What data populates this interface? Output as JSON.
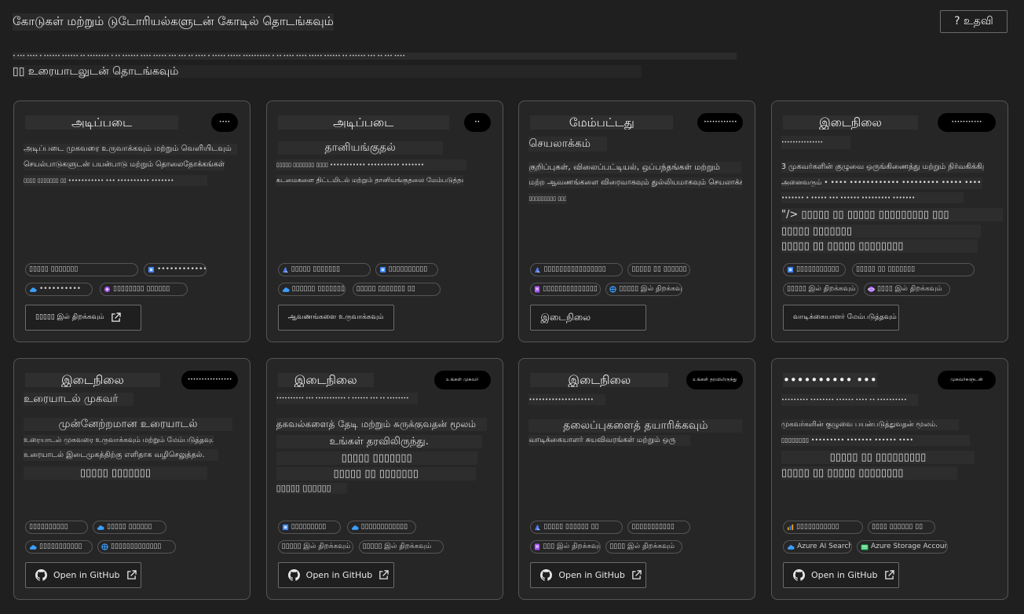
{
  "header": {
    "title": "கோடுகள் மற்றும் டுடோரியல்களுடன் கோடில் தொடங்கவும்",
    "help_label": "? உதவி",
    "subtitle": "• ••• •••• • •••••• •••••• •• •••••••• • •• •••••• •••• ••••• ••• ••• •• •••• • ••••• ••••• •••••••••• • •• •••• •••• ••••• •••••• •• •••••• ••• •• ••• ••••",
    "section_heading": "▯▯ உரையாடலுடன் தொடங்கவும்"
  },
  "colors": {
    "background": "#1f1f1f",
    "card_background": "#262626",
    "card_border": "#555555",
    "text": "#e6e6e6",
    "badge_background": "#000000"
  },
  "cards": [
    {
      "title": "அடிப்படை",
      "badge": "••••",
      "lines": [
        "அடிப்படை முகவரை உருவாக்கவும் மற்றும் வெளியிடவும்",
        "செயல்பாடுகளுடன் பயன்பாடு மற்றும் தொலைநோக்கங்கள்",
        "▯▯▯▯ ▯▯▯▯▯▯▯ ▯▯ ••••••••••• ••• •••••••••• •••••••"
      ],
      "tags": [
        {
          "label": "▯▯▯▯▯ ▯▯▯▯▯▯▯",
          "icon": "none",
          "color": ""
        },
        {
          "label": "•••••••••••••••",
          "icon": "cube-icon",
          "color": "#3b82f6"
        },
        {
          "label": "••••••••••",
          "icon": "cloud-icon",
          "color": "#3b9eff"
        },
        {
          "label": "▯▯▯▯▯▯▯▯ ▯▯▯▯▯▯",
          "icon": "sparkle-icon",
          "color": "#a855f7"
        }
      ],
      "button": "▯▯▯▯▯ இல் திறக்கவும்"
    },
    {
      "title": "அடிப்படை",
      "badge": "••",
      "lines": [
        "தானியங்குதல்",
        "▯▯▯▯▯ ▯▯▯▯▯▯▯ ▯▯▯▯ ••••••••••• •••••••••• •••••••",
        "கடமைகளை திட்டமிடல் மற்றும் தானியங்குதலை மேம்படுத்தவும்"
      ],
      "tags": [
        {
          "label": "▯▯▯▯▯ ▯▯▯▯▯▯▯",
          "icon": "azure-icon",
          "color": "#4f7cff"
        },
        {
          "label": "▯▯▯▯▯▯▯▯▯▯",
          "icon": "cube-icon",
          "color": "#3b82f6"
        },
        {
          "label": "▯▯▯▯▯▯ ▯▯▯▯▯▯▯ ▯▯",
          "icon": "cloud-icon",
          "color": "#3b9eff"
        },
        {
          "label": "▯▯▯▯▯ ▯▯▯▯▯▯▯ ▯▯",
          "icon": "none",
          "color": ""
        }
      ],
      "button": "ஆவணங்களை உருவாக்கவும்"
    },
    {
      "title": "மேம்பட்டது",
      "badge": "••••••••••••",
      "lines": [
        "செயலாக்கம்",
        "குறிப்புகள், விலைப்பட்டியல், ஒப்பந்தங்கள் மற்றும்",
        "மற்ற ஆவணங்களை விரைவாகவும் துல்லியமாகவும் செயலாக்கவும்",
        "▯▯▯▯▯▯▯▯▯ ▯▯▯▯▯▯"
      ],
      "tags": [
        {
          "label": "▯▯▯▯▯▯▯▯▯▯▯▯▯▯▯▯",
          "icon": "azure-icon",
          "color": "#4f7cff"
        },
        {
          "label": "▯▯▯▯▯ ▯▯ ▯▯▯▯▯▯",
          "icon": "none",
          "color": ""
        },
        {
          "label": "▯▯▯▯▯▯▯▯▯▯▯▯▯▯",
          "icon": "doc-icon",
          "color": "#a855f7"
        },
        {
          "label": "▯▯▯▯▯ இல் திறக்கவும்",
          "icon": "globe-icon",
          "color": "#3b9eff"
        }
      ],
      "button": "இடைநிலை"
    },
    {
      "title": "இடைநிலை",
      "badge": "•••••••••••",
      "lines": [
        "•••••••••••••••",
        "3 முகவர்களின் குழுவை ஒருங்கிணைத்து மற்றும் நிர்வகிக்கிறது",
        "அனைவரும் • •••• •••••••••••• ••••••••• ••••• ••••",
        "••••••• • ••••• ••• •••••• ••••••••• •••••••",
        "\"/> ▯▯▯▯▯ ▯▯ ▯▯▯▯▯ ▯▯▯▯▯▯▯▯▯ ▯▯▯",
        "▯▯▯▯▯ ▯▯▯▯▯▯▯",
        "▯▯▯▯▯ ▯▯ ▯▯▯▯▯ ▯▯▯▯▯▯▯▯"
      ],
      "tags": [
        {
          "label": "▯▯▯▯▯▯▯▯▯▯▯",
          "icon": "cube-icon",
          "color": "#3b82f6"
        },
        {
          "label": "▯▯▯▯▯ ▯▯ ▯▯▯▯▯▯▯",
          "icon": "none",
          "color": ""
        },
        {
          "label": "▯▯▯▯▯ இல் திறக்கவும்",
          "icon": "none",
          "color": ""
        },
        {
          "label": "▯▯▯▯ இல் திறக்கவும்",
          "icon": "cosmos-icon",
          "color": "#a855f7"
        }
      ],
      "button": "வாடிக்கையாளர் மேம்படுத்தவும்"
    },
    {
      "title": "இடைநிலை",
      "badge": "••••••••••••••••",
      "lines": [
        "உரையாடல் முகவர்",
        "முன்னேற்றமான உரையாடல்",
        "உரையாடல் முகவரை உருவாக்கவும் மற்றும் மேம்படுத்தவும்",
        "உரையாடல் இடைமுகத்திற்கு எளிதாக வழிசெலுத்தல்.",
        "▯▯▯▯▯ ▯▯▯▯▯▯▯"
      ],
      "tags": [
        {
          "label": "▯▯▯▯▯▯▯▯▯▯",
          "icon": "none",
          "color": ""
        },
        {
          "label": "▯▯▯▯▯ ▯▯▯▯▯▯",
          "icon": "cloud-icon",
          "color": "#3b9eff"
        },
        {
          "label": "▯▯▯▯▯▯▯▯▯▯▯",
          "icon": "cloud-icon",
          "color": "#3b9eff"
        },
        {
          "label": "▯▯▯▯▯▯▯▯▯▯▯▯▯",
          "icon": "globe-icon",
          "color": "#3b9eff"
        }
      ],
      "button": "Open in GitHub"
    },
    {
      "title": "இடைநிலை",
      "badge": "உங்கள் முகவர்",
      "lines": [
        "•••••••••• ••• ••••••••••• • •••••• ••• •• ••••••••",
        "தகவல்களைத் தேடி மற்றும் சுருக்குவதன் மூலம்",
        "உங்கள் தரவிலிருந்து.",
        "▯▯▯▯▯ ▯▯▯▯▯▯▯",
        "▯▯▯▯▯ ▯▯ ▯▯▯▯▯▯▯",
        "▯▯▯▯▯ ▯▯▯▯▯▯"
      ],
      "tags": [
        {
          "label": "▯▯▯▯▯▯▯▯▯",
          "icon": "cube-icon",
          "color": "#3b82f6"
        },
        {
          "label": "▯▯▯▯▯▯▯▯▯▯▯▯",
          "icon": "cloud-icon",
          "color": "#3b9eff"
        },
        {
          "label": "▯▯▯▯▯ இல் திறக்கவும்",
          "icon": "none",
          "color": ""
        },
        {
          "label": "▯▯▯▯▯ இல் திறக்கவும்",
          "icon": "none",
          "color": ""
        }
      ],
      "button": "Open in GitHub"
    },
    {
      "title": "இடைநிலை",
      "badge": "உங்கள் தரவிலிருந்து",
      "lines": [
        "••••••••••••••••••••",
        "தலைப்புகளைத் தயாரிக்கவும்",
        "வாடிக்கையாளர் சுயவிவரங்கள் மற்றும் ஒரு"
      ],
      "tags": [
        {
          "label": "▯▯▯▯▯ ▯▯▯▯▯▯ ▯▯",
          "icon": "azure-icon",
          "color": "#4f7cff"
        },
        {
          "label": "▯▯▯▯▯▯▯▯▯▯▯",
          "icon": "none",
          "color": ""
        },
        {
          "label": "▯▯▯ இல் திறக்கவும்",
          "icon": "doc-icon",
          "color": "#a855f7"
        },
        {
          "label": "▯▯▯▯ இல் திறக்கவும்",
          "icon": "none",
          "color": ""
        }
      ],
      "button": "Open in GitHub"
    },
    {
      "title": "•••••••••• ••••••••",
      "badge": "முகவர்களுடன்",
      "lines": [
        "••••••••• •••••••• •••••• •••• •• ••••••••••",
        "முகவர்களின் குழுவை பயன்படுத்துவதன் மூலம்.",
        "▯▯▯▯▯▯▯▯ ••••••••• ••••••• •••••• ••••",
        "▯▯▯▯▯ ▯▯ ▯▯▯▯▯▯▯▯▯",
        "▯▯▯▯▯ ▯▯ ▯▯▯▯▯ ▯▯▯▯▯▯▯▯"
      ],
      "tags": [
        {
          "label": "▯▯▯▯▯▯▯▯▯▯▯",
          "icon": "chart-icon",
          "color": "#f59e0b"
        },
        {
          "label": "▯▯▯▯ ▯▯▯▯▯▯ ▯▯",
          "icon": "none",
          "color": ""
        },
        {
          "label": "Azure AI Search",
          "icon": "cloud-icon",
          "color": "#3b9eff"
        },
        {
          "label": "Azure Storage Account",
          "icon": "storage-icon",
          "color": "#22c55e"
        }
      ],
      "button": "Open in GitHub"
    }
  ]
}
